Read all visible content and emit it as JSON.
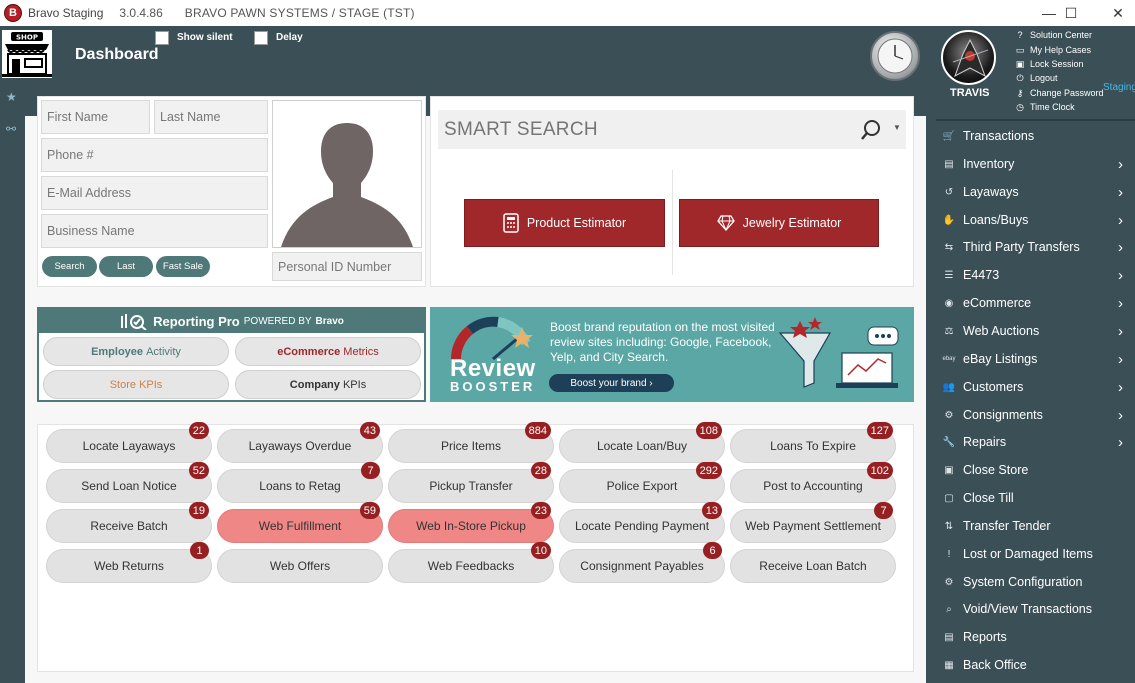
{
  "window": {
    "app_name": "Bravo Staging",
    "version": "3.0.4.86",
    "context": "BRAVO PAWN SYSTEMS / STAGE (TST)",
    "logo_letter": "B",
    "controls": [
      "—",
      "☐",
      "✕"
    ]
  },
  "header": {
    "title": "Dashboard",
    "shop_logo_text": "SHOP",
    "show_silent_label": "Show silent",
    "delay_label": "Delay",
    "username": "TRAVIS",
    "user_links": [
      {
        "label": "Solution Center",
        "icon": "help-icon"
      },
      {
        "label": "My Help Cases",
        "icon": "folder-icon"
      },
      {
        "label": "Lock Session",
        "icon": "lock-icon"
      },
      {
        "label": "Logout",
        "icon": "logout-icon"
      },
      {
        "label": "Change Password",
        "icon": "key-icon"
      },
      {
        "label": "Time Clock",
        "icon": "clock-icon"
      }
    ],
    "environment": "Staging"
  },
  "customer_search": {
    "first_name_placeholder": "First Name",
    "last_name_placeholder": "Last Name",
    "phone_placeholder": "Phone #",
    "email_placeholder": "E-Mail Address",
    "business_placeholder": "Business Name",
    "personal_id_placeholder": "Personal ID Number",
    "buttons": [
      "Search",
      "Last",
      "Fast Sale"
    ]
  },
  "smart_search": {
    "placeholder": "SMART SEARCH"
  },
  "estimators": {
    "product": "Product Estimator",
    "jewelry": "Jewelry Estimator"
  },
  "reporting_pro": {
    "title": "Reporting Pro",
    "powered_by": "POWERED BY",
    "brand": "Bravo",
    "buttons": [
      {
        "label_a": "Employee",
        "label_b": "Activity",
        "color_a": "#4f7978",
        "color_b": "#4f7978"
      },
      {
        "label_a": "eCommerce",
        "label_b": "Metrics",
        "color_a": "#a0272a",
        "color_b": "#a0272a"
      },
      {
        "label_a": "Store",
        "label_b": "KPIs",
        "color_a": "#c8834a",
        "color_b": "#c8834a"
      },
      {
        "label_a": "Company",
        "label_b": "KPIs",
        "color_a": "#333333",
        "color_b": "#333333"
      }
    ]
  },
  "review_booster": {
    "title_main": "Review",
    "title_sub": "BOOSTER",
    "text": "Boost brand reputation on the most visited review sites including: Google, Facebook, Yelp, and City Search.",
    "cta": "Boost your brand ›"
  },
  "tiles": [
    {
      "label": "Locate Layaways",
      "badge": "22",
      "highlight": false
    },
    {
      "label": "Layaways Overdue",
      "badge": "43",
      "highlight": false
    },
    {
      "label": "Price Items",
      "badge": "884",
      "highlight": false
    },
    {
      "label": "Locate Loan/Buy",
      "badge": "108",
      "highlight": false
    },
    {
      "label": "Loans To Expire",
      "badge": "127",
      "highlight": false
    },
    {
      "label": "Send Loan Notice",
      "badge": "52",
      "highlight": false
    },
    {
      "label": "Loans to Retag",
      "badge": "7",
      "highlight": false
    },
    {
      "label": "Pickup Transfer",
      "badge": "28",
      "highlight": false
    },
    {
      "label": "Police Export",
      "badge": "292",
      "highlight": false
    },
    {
      "label": "Post to Accounting",
      "badge": "102",
      "highlight": false
    },
    {
      "label": "Receive Batch",
      "badge": "19",
      "highlight": false
    },
    {
      "label": "Web Fulfillment",
      "badge": "59",
      "highlight": true
    },
    {
      "label": "Web In-Store Pickup",
      "badge": "23",
      "highlight": true
    },
    {
      "label": "Locate Pending Payment",
      "badge": "13",
      "highlight": false
    },
    {
      "label": "Web Payment Settlement",
      "badge": "7",
      "highlight": false
    },
    {
      "label": "Web Returns",
      "badge": "1",
      "highlight": false
    },
    {
      "label": "Web Offers",
      "badge": "",
      "highlight": false
    },
    {
      "label": "Web Feedbacks",
      "badge": "10",
      "highlight": false
    },
    {
      "label": "Consignment Payables",
      "badge": "6",
      "highlight": false
    },
    {
      "label": "Receive Loan Batch",
      "badge": "",
      "highlight": false
    }
  ],
  "menu": [
    {
      "label": "Transactions",
      "icon": "cart-icon",
      "glyph": "🛒",
      "submenu": false
    },
    {
      "label": "Inventory",
      "icon": "chart-icon",
      "glyph": "▤",
      "submenu": true
    },
    {
      "label": "Layaways",
      "icon": "history-icon",
      "glyph": "↺",
      "submenu": true
    },
    {
      "label": "Loans/Buys",
      "icon": "handshake-icon",
      "glyph": "✋",
      "submenu": true
    },
    {
      "label": "Third Party Transfers",
      "icon": "transfer-icon",
      "glyph": "⇆",
      "submenu": true
    },
    {
      "label": "E4473",
      "icon": "list-icon",
      "glyph": "☰",
      "submenu": true
    },
    {
      "label": "eCommerce",
      "icon": "globe-icon",
      "glyph": "◉",
      "submenu": true
    },
    {
      "label": "Web Auctions",
      "icon": "gavel-icon",
      "glyph": "⚖",
      "submenu": true
    },
    {
      "label": "eBay Listings",
      "icon": "ebay-icon",
      "glyph": "ebay",
      "submenu": true
    },
    {
      "label": "Customers",
      "icon": "users-icon",
      "glyph": "👥",
      "submenu": true
    },
    {
      "label": "Consignments",
      "icon": "consign-icon",
      "glyph": "⚙",
      "submenu": true
    },
    {
      "label": "Repairs",
      "icon": "wrench-icon",
      "glyph": "🔧",
      "submenu": true
    },
    {
      "label": "Close Store",
      "icon": "close-store-icon",
      "glyph": "▣",
      "submenu": false
    },
    {
      "label": "Close Till",
      "icon": "till-icon",
      "glyph": "▢",
      "submenu": false
    },
    {
      "label": "Transfer Tender",
      "icon": "tender-icon",
      "glyph": "⇅",
      "submenu": false
    },
    {
      "label": "Lost or Damaged Items",
      "icon": "alert-icon",
      "glyph": "!",
      "submenu": false
    },
    {
      "label": "System Configuration",
      "icon": "cogs-icon",
      "glyph": "⚙",
      "submenu": false
    },
    {
      "label": "Void/View Transactions",
      "icon": "search-icon",
      "glyph": "⌕",
      "submenu": false
    },
    {
      "label": "Reports",
      "icon": "report-icon",
      "glyph": "▤",
      "submenu": false
    },
    {
      "label": "Back Office",
      "icon": "office-icon",
      "glyph": "▦",
      "submenu": false
    }
  ]
}
